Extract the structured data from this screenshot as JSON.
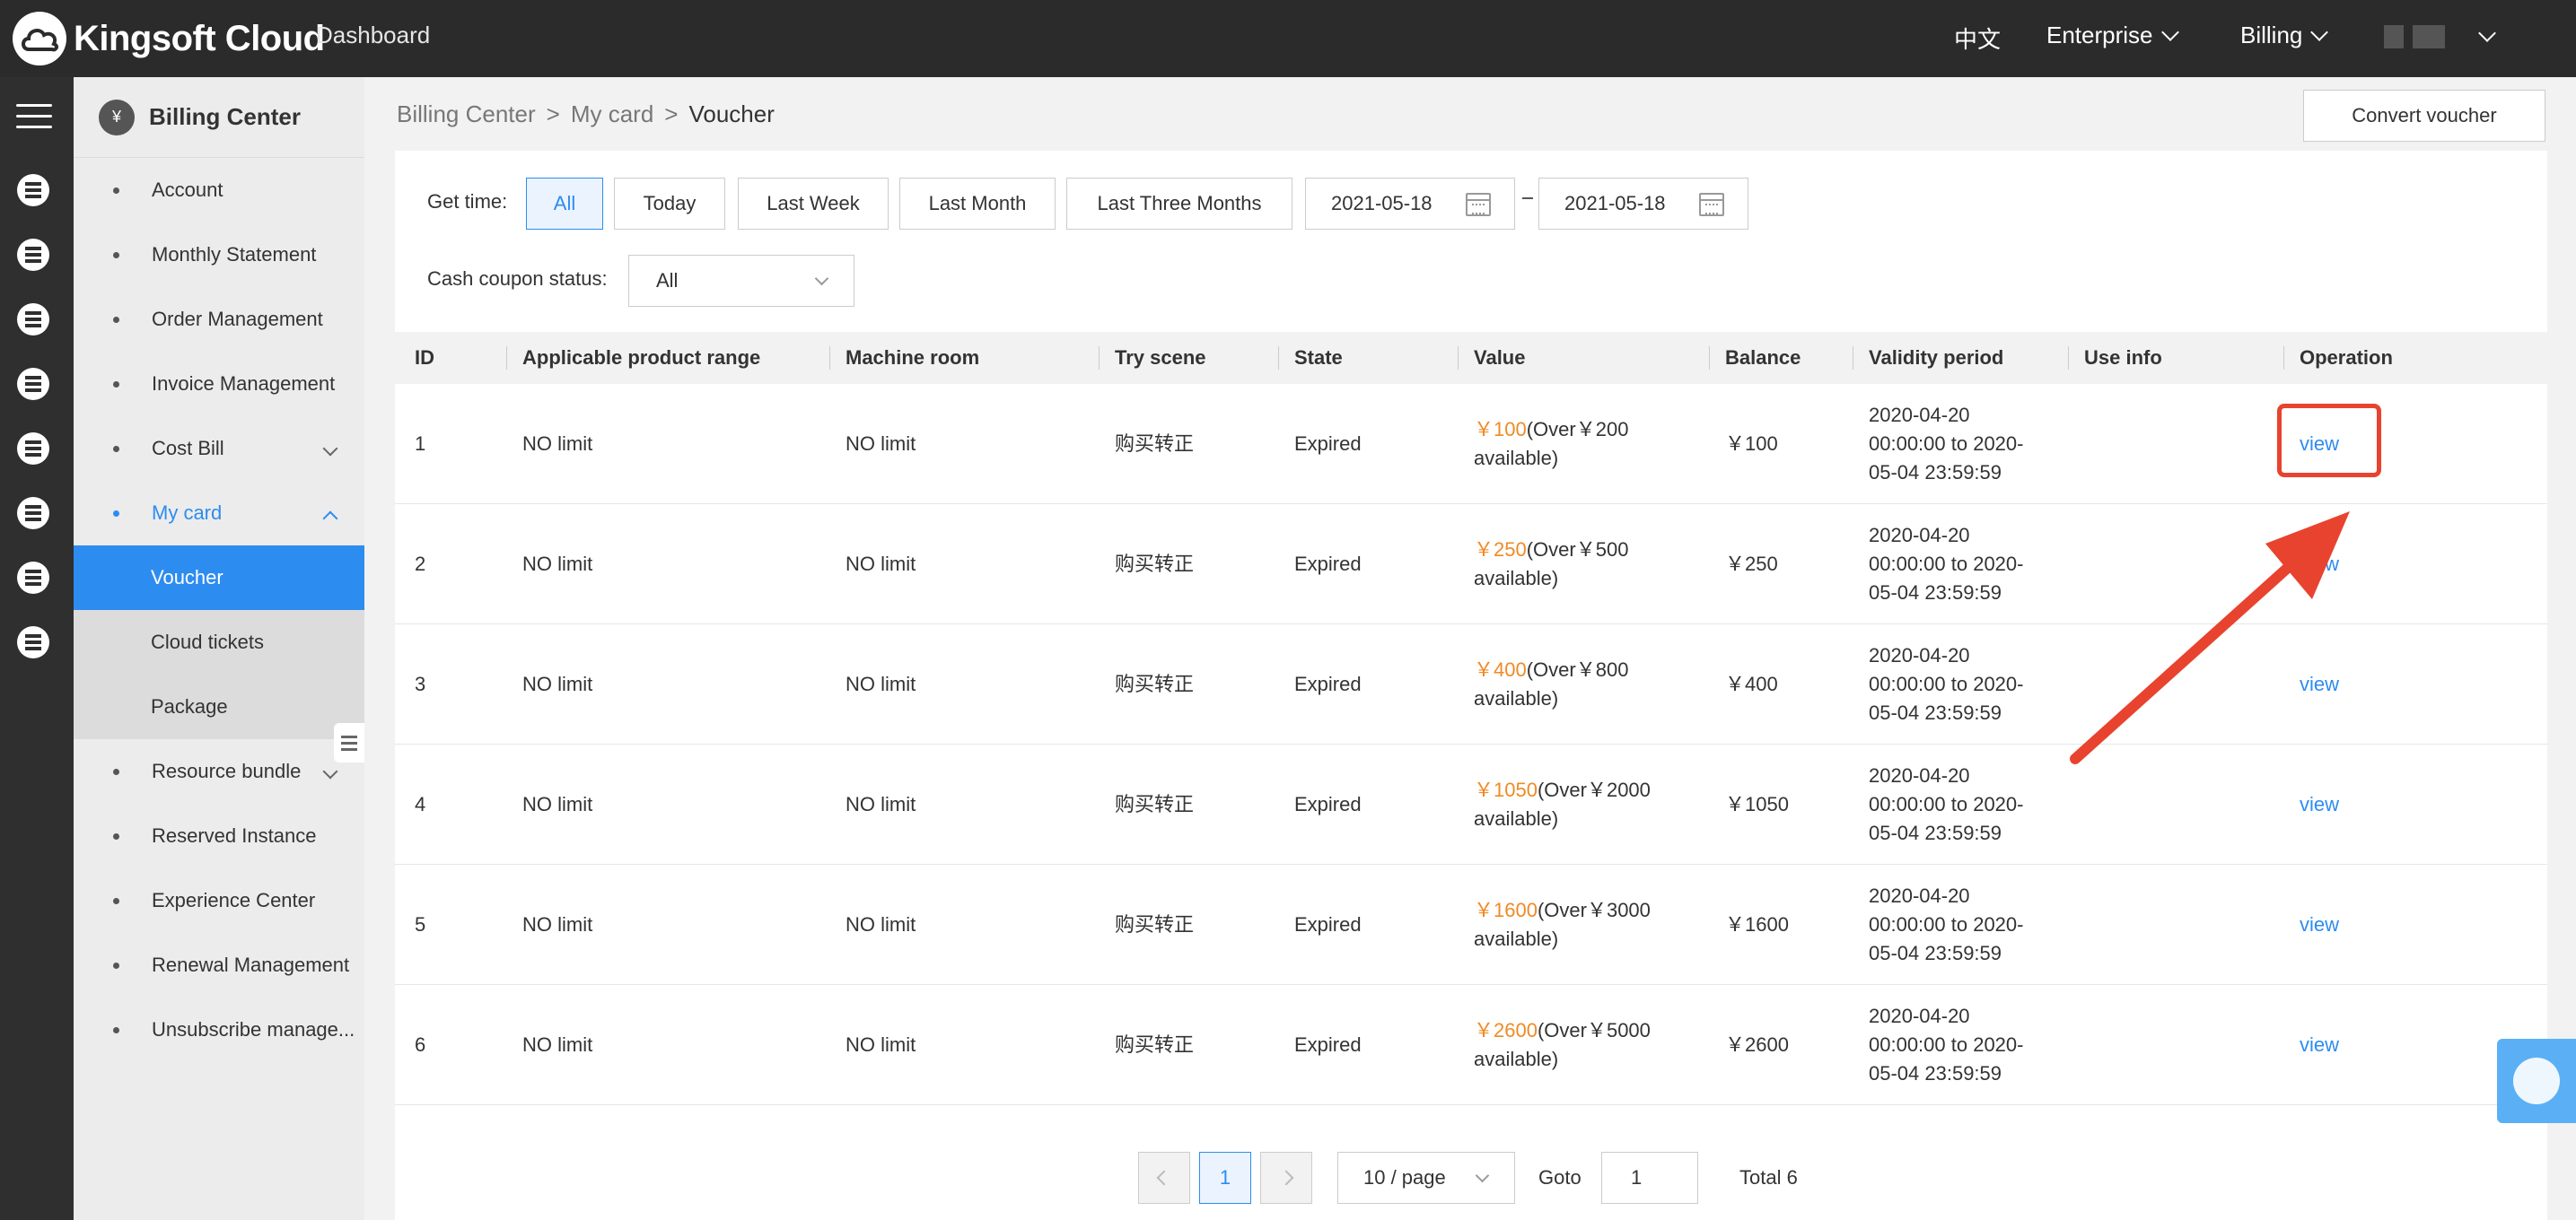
{
  "topbar": {
    "brand": "Kingsoft Cloud",
    "dashboard": "Dashboard",
    "language": "中文",
    "enterprise": "Enterprise",
    "billing": "Billing"
  },
  "sidebar": {
    "title": "Billing Center",
    "items": [
      {
        "label": "Account"
      },
      {
        "label": "Monthly Statement"
      },
      {
        "label": "Order Management"
      },
      {
        "label": "Invoice Management"
      },
      {
        "label": "Cost Bill"
      },
      {
        "label": "My card"
      },
      {
        "label": "Resource bundle"
      },
      {
        "label": "Reserved Instance"
      },
      {
        "label": "Experience Center"
      },
      {
        "label": "Renewal Management"
      },
      {
        "label": "Unsubscribe manage..."
      }
    ],
    "subitems": [
      {
        "label": "Voucher"
      },
      {
        "label": "Cloud tickets"
      },
      {
        "label": "Package"
      }
    ]
  },
  "breadcrumb": {
    "root": "Billing Center",
    "sep1": ">",
    "mid": "My card",
    "sep2": ">",
    "current": "Voucher"
  },
  "convert_label": "Convert voucher",
  "filters": {
    "get_time_label": "Get time:",
    "ranges": [
      "All",
      "Today",
      "Last Week",
      "Last Month",
      "Last Three Months"
    ],
    "date_from": "2021-05-18",
    "date_to": "2021-05-18",
    "status_label": "Cash coupon status:",
    "status_value": "All"
  },
  "table": {
    "columns": [
      "ID",
      "Applicable product range",
      "Machine room",
      "Try scene",
      "State",
      "Value",
      "Balance",
      "Validity period",
      "Use info",
      "Operation"
    ],
    "rows": [
      {
        "id": "1",
        "range": "NO limit",
        "room": "NO limit",
        "scene": "购买转正",
        "state": "Expired",
        "value": "￥100",
        "over_l1": "(Over￥200",
        "over_l2": "available)",
        "balance": "￥100",
        "valid_l1": "2020-04-20",
        "valid_l2": "00:00:00 to 2020-",
        "valid_l3": "05-04 23:59:59",
        "op": "view"
      },
      {
        "id": "2",
        "range": "NO limit",
        "room": "NO limit",
        "scene": "购买转正",
        "state": "Expired",
        "value": "￥250",
        "over_l1": "(Over￥500",
        "over_l2": "available)",
        "balance": "￥250",
        "valid_l1": "2020-04-20",
        "valid_l2": "00:00:00 to 2020-",
        "valid_l3": "05-04 23:59:59",
        "op": "view"
      },
      {
        "id": "3",
        "range": "NO limit",
        "room": "NO limit",
        "scene": "购买转正",
        "state": "Expired",
        "value": "￥400",
        "over_l1": "(Over￥800",
        "over_l2": "available)",
        "balance": "￥400",
        "valid_l1": "2020-04-20",
        "valid_l2": "00:00:00 to 2020-",
        "valid_l3": "05-04 23:59:59",
        "op": "view"
      },
      {
        "id": "4",
        "range": "NO limit",
        "room": "NO limit",
        "scene": "购买转正",
        "state": "Expired",
        "value": "￥1050",
        "over_l1": "(Over￥2000",
        "over_l2": "available)",
        "balance": "￥1050",
        "valid_l1": "2020-04-20",
        "valid_l2": "00:00:00 to 2020-",
        "valid_l3": "05-04 23:59:59",
        "op": "view"
      },
      {
        "id": "5",
        "range": "NO limit",
        "room": "NO limit",
        "scene": "购买转正",
        "state": "Expired",
        "value": "￥1600",
        "over_l1": "(Over￥3000",
        "over_l2": "available)",
        "balance": "￥1600",
        "valid_l1": "2020-04-20",
        "valid_l2": "00:00:00 to 2020-",
        "valid_l3": "05-04 23:59:59",
        "op": "view"
      },
      {
        "id": "6",
        "range": "NO limit",
        "room": "NO limit",
        "scene": "购买转正",
        "state": "Expired",
        "value": "￥2600",
        "over_l1": "(Over￥5000",
        "over_l2": "available)",
        "balance": "￥2600",
        "valid_l1": "2020-04-20",
        "valid_l2": "00:00:00 to 2020-",
        "valid_l3": "05-04 23:59:59",
        "op": "view"
      }
    ]
  },
  "pagination": {
    "current_page": "1",
    "page_size": "10 / page",
    "goto_label": "Goto",
    "goto_value": "1",
    "total": "Total 6"
  },
  "colors": {
    "accent": "#2d8cf0",
    "value_orange": "#f08a24",
    "highlight_red": "#e8432e",
    "topbar": "#2b2b2b"
  }
}
